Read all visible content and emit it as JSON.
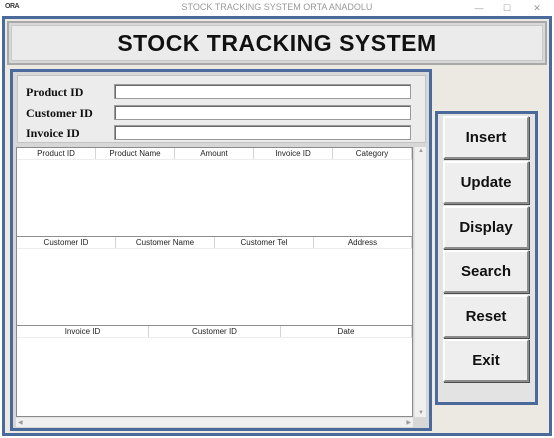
{
  "window": {
    "app_icon_text": "ORA",
    "title": "STOCK TRACKING SYSTEM ORTA ANADOLU",
    "controls": [
      "—",
      "☐",
      "✕"
    ]
  },
  "header": {
    "title": "STOCK TRACKING SYSTEM"
  },
  "form": {
    "product_id": {
      "label": "Product ID",
      "value": ""
    },
    "customer_id": {
      "label": "Customer ID",
      "value": ""
    },
    "invoice_id": {
      "label": "Invoice ID",
      "value": ""
    }
  },
  "product_list": {
    "columns": [
      "Product ID",
      "Product Name",
      "Amount",
      "Invoice ID",
      "Category"
    ]
  },
  "customer_list": {
    "columns": [
      "Customer ID",
      "Customer Name",
      "Customer Tel",
      "Address"
    ]
  },
  "invoice_list": {
    "columns": [
      "Invoice ID",
      "Customer ID",
      "Date"
    ]
  },
  "buttons": {
    "insert": "Insert",
    "update": "Update",
    "display": "Display",
    "search": "Search",
    "reset": "Reset",
    "exit": "Exit"
  },
  "scrollbar": {
    "up": "▲",
    "down": "▼",
    "left": "◀",
    "right": "▶"
  }
}
